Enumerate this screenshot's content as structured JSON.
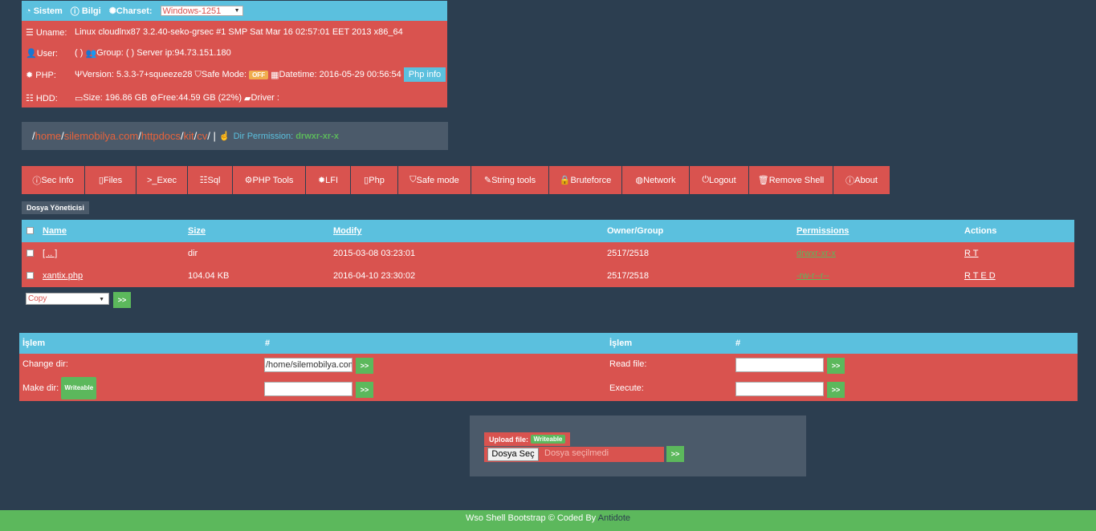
{
  "info": {
    "sistem_label": "Sistem",
    "bilgi_label": "Bilgi",
    "charset_label": "Charset:",
    "charset_value": "Windows-1251",
    "uname_label": "Uname:",
    "uname_value": "Linux cloudlnx87 3.2.40-seko-grsec #1 SMP Sat Mar 16 02:57:01 EET 2013 x86_64",
    "user_label": "User:",
    "user_value": "( )",
    "group_label": "Group: ( ) Server ip:94.73.151.180",
    "php_label": "PHP:",
    "php_version": "Version: 5.3.3-7+squeeze28",
    "safe_mode_label": "Safe Mode:",
    "safe_mode_value": "OFF",
    "datetime": "Datetime: 2016-05-29 00:56:54",
    "phpinfo_button": "Php info",
    "hdd_label": "HDD:",
    "hdd_size": "Size: 196.86 GB",
    "hdd_free": "Free:44.59 GB (22%)",
    "hdd_driver": "Driver :"
  },
  "path": {
    "segments": [
      "home",
      "silemobilya.com",
      "httpdocs",
      "kit",
      "cv"
    ],
    "permission_label": "Dir Permission:",
    "permission_value": "drwxr-xr-x"
  },
  "menu": [
    {
      "label": "Sec Info",
      "icon": "info-icon"
    },
    {
      "label": "Files",
      "icon": "file-icon"
    },
    {
      "label": ">_Exec",
      "icon": ""
    },
    {
      "label": "Sql",
      "icon": "database-icon"
    },
    {
      "label": "PHP Tools",
      "icon": "gear-icon"
    },
    {
      "label": "LFI",
      "icon": "bug-icon"
    },
    {
      "label": "Php",
      "icon": "code-file-icon"
    },
    {
      "label": "Safe mode",
      "icon": "shield-icon"
    },
    {
      "label": "String tools",
      "icon": "edit-icon"
    },
    {
      "label": "Bruteforce",
      "icon": "lock-icon"
    },
    {
      "label": "Network",
      "icon": "globe-icon"
    },
    {
      "label": "Logout",
      "icon": "power-icon"
    },
    {
      "label": "Remove Shell",
      "icon": "trash-icon"
    },
    {
      "label": "About",
      "icon": "info-icon"
    }
  ],
  "file_manager": {
    "title": "Dosya Yöneticisi",
    "headers": {
      "name": "Name",
      "size": "Size",
      "modify": "Modify",
      "owner": "Owner/Group",
      "permissions": "Permissions",
      "actions": "Actions"
    },
    "rows": [
      {
        "name": "[ .. ]",
        "size": "dir",
        "modify": "2015-03-08 03:23:01",
        "owner": "2517/2518",
        "permissions": "drwxr-xr-x",
        "actions": "R T"
      },
      {
        "name": "xantix.php",
        "size": "104.04 KB",
        "modify": "2016-04-10 23:30:02",
        "owner": "2517/2518",
        "permissions": "-rw-r--r--",
        "actions": "R T E D"
      }
    ],
    "bulk_select": "Copy",
    "go_label": ">>"
  },
  "actions": {
    "head_islem": "İşlem",
    "head_hash": "#",
    "change_dir_label": "Change dir:",
    "change_dir_value": "/home/silemobilya.com",
    "make_dir_label": "Make dir:",
    "writeable": "Writeable",
    "read_file_label": "Read file:",
    "execute_label": "Execute:",
    "go_label": ">>"
  },
  "upload": {
    "label": "Upload file:",
    "writeable": "Writeable",
    "choose_button": "Dosya Seç",
    "no_file": "Dosya seçilmedi",
    "go_label": ">>"
  },
  "footer": {
    "text": "Wso Shell Bootstrap © Coded By",
    "author": "Antidote"
  }
}
